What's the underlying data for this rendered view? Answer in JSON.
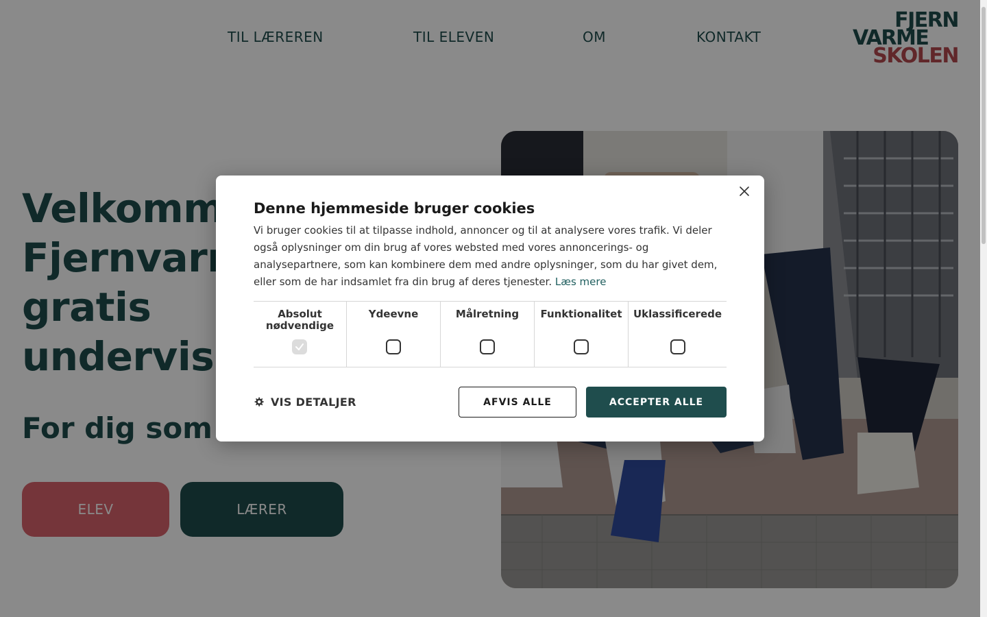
{
  "nav": {
    "items": [
      "TIL LÆREREN",
      "TIL ELEVEN",
      "OM",
      "KONTAKT"
    ],
    "logo": {
      "line1": "FJERN",
      "line2": "VARME",
      "line3": "SKOLEN"
    }
  },
  "hero": {
    "title_lines": [
      "Velkomm",
      "Fjernvarm",
      "gratis",
      "undervisn"
    ],
    "subtitle": "For dig som",
    "btn_elev": "ELEV",
    "btn_laerer": "LÆRER"
  },
  "cookie": {
    "title": "Denne hjemmeside bruger cookies",
    "text": "Vi bruger cookies til at tilpasse indhold, annoncer og til at analysere vores trafik. Vi deler også oplysninger om din brug af vores websted med vores annoncerings- og analysepartnere, som kan kombinere dem med andre oplysninger, som du har givet dem, eller som de har indsamlet fra din brug af deres tjenester.",
    "read_more": "Læs mere",
    "categories": [
      {
        "label_line1": "Absolut",
        "label_line2": "nødvendige",
        "checked": true
      },
      {
        "label_line1": "Ydeevne",
        "label_line2": "",
        "checked": false
      },
      {
        "label_line1": "Målretning",
        "label_line2": "",
        "checked": false
      },
      {
        "label_line1": "Funktionalitet",
        "label_line2": "",
        "checked": false
      },
      {
        "label_line1": "Uklassificerede",
        "label_line2": "",
        "checked": false
      }
    ],
    "details": "VIS DETALJER",
    "reject": "AFVIS ALLE",
    "accept": "ACCEPTER ALLE"
  },
  "colors": {
    "primary": "#1f4d4d",
    "accent": "#d9636b",
    "logo_red": "#b3484f"
  },
  "icons": {
    "close": "close-icon",
    "gear": "gear-icon",
    "check": "check-icon"
  }
}
